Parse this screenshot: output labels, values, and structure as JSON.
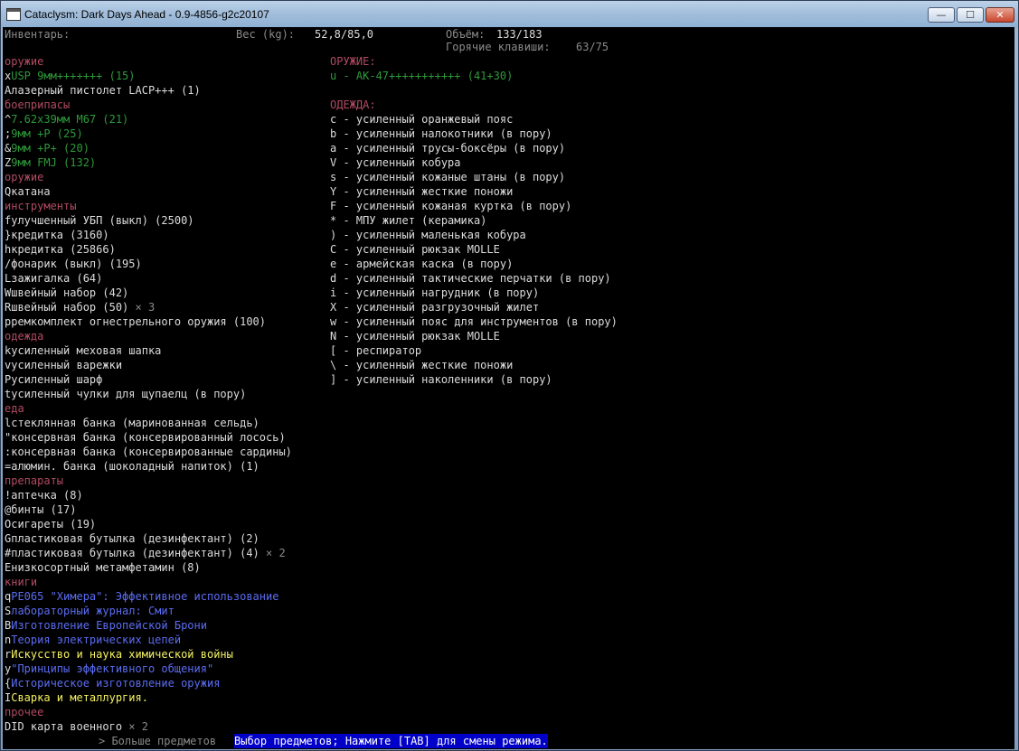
{
  "window": {
    "title": "Cataclysm: Dark Days Ahead - 0.9-4856-g2c20107",
    "minimize_glyph": "—",
    "maximize_glyph": "☐",
    "close_glyph": "✕"
  },
  "header": {
    "inventory_label": "Инвентарь:",
    "weight_label": "Вес (kg):",
    "weight_value": "52,8/85,0",
    "volume_label": "Объём:",
    "volume_value": "133/183",
    "hotkeys_label": "Горячие клавиши:",
    "hotkeys_value": "63/75"
  },
  "left_list": [
    {
      "key": "",
      "text": "оружие",
      "style": "cat"
    },
    {
      "key": "x",
      "text": "USP 9мм+++++++ (15)",
      "style": "gr"
    },
    {
      "key": "A",
      "text": "лазерный пистолет LACP+++ (1)",
      "style": "wh"
    },
    {
      "key": "",
      "text": "боеприпасы",
      "style": "cat"
    },
    {
      "key": "^",
      "text": "7.62x39мм M67 (21)",
      "style": "gr"
    },
    {
      "key": ";",
      "text": "9мм +P (25)",
      "style": "gr"
    },
    {
      "key": "&",
      "text": "9мм +P+ (20)",
      "style": "gr"
    },
    {
      "key": "Z",
      "text": "9мм FMJ (132)",
      "style": "gr"
    },
    {
      "key": "",
      "text": "оружие",
      "style": "cat"
    },
    {
      "key": "Q",
      "text": "катана",
      "style": "wh"
    },
    {
      "key": "",
      "text": "инструменты",
      "style": "cat"
    },
    {
      "key": "f",
      "text": "улучшенный УБП (выкл) (2500)",
      "style": "wh"
    },
    {
      "key": "}",
      "text": "кредитка (3160)",
      "style": "wh"
    },
    {
      "key": "h",
      "text": "кредитка (25866)",
      "style": "wh"
    },
    {
      "key": "/",
      "text": "фонарик (выкл) (195)",
      "style": "wh"
    },
    {
      "key": "L",
      "text": "зажигалка (64)",
      "style": "wh"
    },
    {
      "key": "W",
      "text": "швейный набор (42)",
      "style": "wh"
    },
    {
      "key": "R",
      "text": "швейный набор (50)",
      "style": "wh",
      "suffix": " × 3"
    },
    {
      "key": "p",
      "text": "ремкомплект огнестрельного оружия (100)",
      "style": "wh"
    },
    {
      "key": "",
      "text": "одежда",
      "style": "cat"
    },
    {
      "key": "k",
      "text": "усиленный меховая шапка",
      "style": "wh"
    },
    {
      "key": "v",
      "text": "усиленный варежки",
      "style": "wh"
    },
    {
      "key": "P",
      "text": "усиленный шарф",
      "style": "wh"
    },
    {
      "key": "t",
      "text": "усиленный чулки для щупаелц (в пору)",
      "style": "wh"
    },
    {
      "key": "",
      "text": "еда",
      "style": "cat"
    },
    {
      "key": "l",
      "text": "стеклянная банка (маринованная сельдь)",
      "style": "wh"
    },
    {
      "key": "\"",
      "text": "консервная банка (консервированный лосось)",
      "style": "wh"
    },
    {
      "key": ":",
      "text": "консервная банка (консервированные сардины)",
      "style": "wh"
    },
    {
      "key": "=",
      "text": "алюмин. банка (шоколадный напиток) (1)",
      "style": "wh"
    },
    {
      "key": "",
      "text": "препараты",
      "style": "cat"
    },
    {
      "key": "!",
      "text": "аптечка (8)",
      "style": "wh"
    },
    {
      "key": "@",
      "text": "бинты (17)",
      "style": "wh"
    },
    {
      "key": "O",
      "text": "сигареты (19)",
      "style": "wh"
    },
    {
      "key": "G",
      "text": "пластиковая бутылка (дезинфектант) (2)",
      "style": "wh"
    },
    {
      "key": "#",
      "text": "пластиковая бутылка (дезинфектант) (4)",
      "style": "wh",
      "suffix": " × 2"
    },
    {
      "key": "E",
      "text": "низкосортный метамфетамин (8)",
      "style": "wh"
    },
    {
      "key": "",
      "text": "книги",
      "style": "cat"
    },
    {
      "key": "q",
      "text": "PE065 \"Химера\": Эффективное использование",
      "style": "bl"
    },
    {
      "key": "S",
      "text": "лабораторный журнал: Смит",
      "style": "bl"
    },
    {
      "key": "B",
      "text": "Изготовление Европейской Брони",
      "style": "bl"
    },
    {
      "key": "n",
      "text": "Теория электрических цепей",
      "style": "bl"
    },
    {
      "key": "r",
      "text": "Искусство и наука химической войны",
      "style": "ye"
    },
    {
      "key": "y",
      "text": "\"Принципы эффективного общения\"",
      "style": "bl"
    },
    {
      "key": "{",
      "text": "Историческое изготовление оружия",
      "style": "bl"
    },
    {
      "key": "I",
      "text": "Сварка и металлургия.",
      "style": "ye"
    },
    {
      "key": "",
      "text": "прочее",
      "style": "cat"
    },
    {
      "key": "D",
      "text": "ID карта военного",
      "style": "wh",
      "suffix": " × 2"
    }
  ],
  "right_list": [
    {
      "key": "",
      "text": "ОРУЖИЕ:",
      "style": "cat",
      "row": 0
    },
    {
      "key": "",
      "text": "u - AK-47+++++++++++ (41+30)",
      "style": "gr",
      "row": 1
    },
    {
      "key": "",
      "text": "ОДЕЖДА:",
      "style": "cat",
      "row": 3
    },
    {
      "key": "",
      "text": "c - усиленный оранжевый пояс",
      "style": "wh",
      "row": 4
    },
    {
      "key": "",
      "text": "b - усиленный налокотники (в пору)",
      "style": "wh",
      "row": 5
    },
    {
      "key": "",
      "text": "a - усиленный трусы-боксёры (в пору)",
      "style": "wh",
      "row": 6
    },
    {
      "key": "",
      "text": "V - усиленный кобура",
      "style": "wh",
      "row": 7
    },
    {
      "key": "",
      "text": "s - усиленный кожаные штаны (в пору)",
      "style": "wh",
      "row": 8
    },
    {
      "key": "",
      "text": "Y - усиленный жесткие поножи",
      "style": "wh",
      "row": 9
    },
    {
      "key": "",
      "text": "F - усиленный кожаная куртка (в пору)",
      "style": "wh",
      "row": 10
    },
    {
      "key": "",
      "text": "* - МПУ жилет (керамика)",
      "style": "wh",
      "row": 11
    },
    {
      "key": "",
      "text": ") - усиленный маленькая кобура",
      "style": "wh",
      "row": 12
    },
    {
      "key": "",
      "text": "C - усиленный рюкзак MOLLE",
      "style": "wh",
      "row": 13
    },
    {
      "key": "",
      "text": "e - армейская каска (в пору)",
      "style": "wh",
      "row": 14
    },
    {
      "key": "",
      "text": "d - усиленный тактические перчатки (в пору)",
      "style": "wh",
      "row": 15
    },
    {
      "key": "",
      "text": "i - усиленный нагрудник (в пору)",
      "style": "wh",
      "row": 16
    },
    {
      "key": "",
      "text": "X - усиленный разгрузочный жилет",
      "style": "wh",
      "row": 17
    },
    {
      "key": "",
      "text": "w - усиленный пояс для инструментов (в пору)",
      "style": "wh",
      "row": 18
    },
    {
      "key": "",
      "text": "N - усиленный рюкзак MOLLE",
      "style": "wh",
      "row": 19
    },
    {
      "key": "",
      "text": "[ - респиратор",
      "style": "wh",
      "row": 20
    },
    {
      "key": "",
      "text": "\\ - усиленный жесткие поножи",
      "style": "wh",
      "row": 21
    },
    {
      "key": "",
      "text": "] - усиленный наколенники (в пору)",
      "style": "wh",
      "row": 22
    }
  ],
  "status": {
    "more_items": "> Больше предметов",
    "hint": "Выбор предметов; Нажмите [TAB] для смены режима."
  }
}
